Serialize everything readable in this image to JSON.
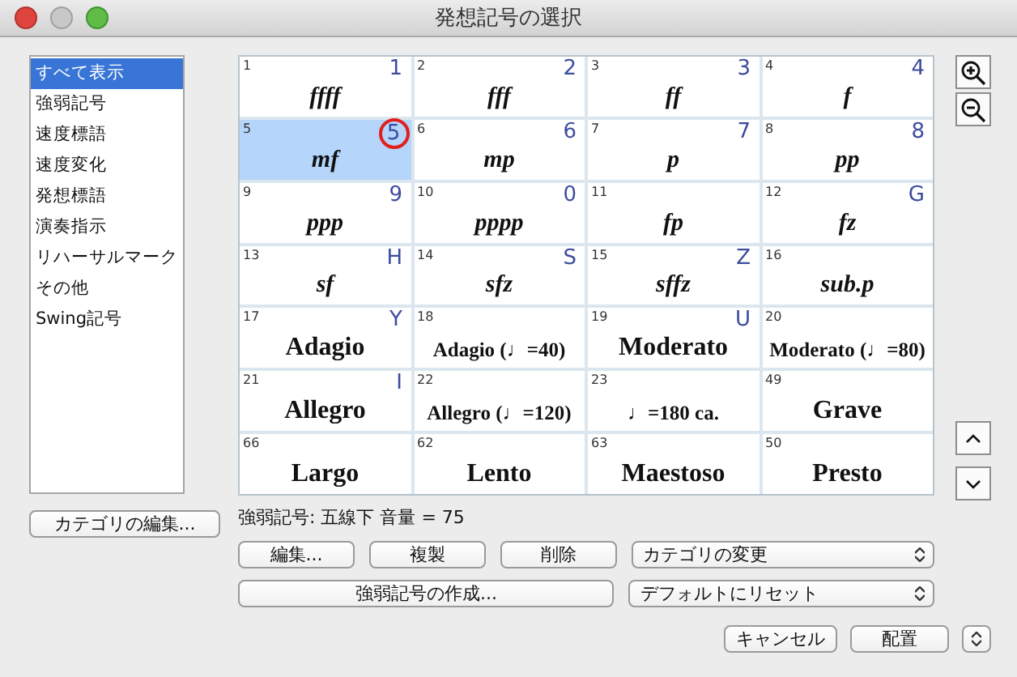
{
  "window": {
    "title": "発想記号の選択"
  },
  "categories": [
    {
      "label": "すべて表示",
      "selected": true
    },
    {
      "label": "強弱記号",
      "selected": false
    },
    {
      "label": "速度標語",
      "selected": false
    },
    {
      "label": "速度変化",
      "selected": false
    },
    {
      "label": "発想標語",
      "selected": false
    },
    {
      "label": "演奏指示",
      "selected": false
    },
    {
      "label": "リハーサルマーク",
      "selected": false
    },
    {
      "label": "その他",
      "selected": false
    },
    {
      "label": "Swing記号",
      "selected": false
    }
  ],
  "edit_categories_button": "カテゴリの編集...",
  "marks": [
    {
      "number": "1",
      "shortcut": "1",
      "label": "ffff",
      "kind": "dynamic",
      "selected": false
    },
    {
      "number": "2",
      "shortcut": "2",
      "label": "fff",
      "kind": "dynamic",
      "selected": false
    },
    {
      "number": "3",
      "shortcut": "3",
      "label": "ff",
      "kind": "dynamic",
      "selected": false
    },
    {
      "number": "4",
      "shortcut": "4",
      "label": "f",
      "kind": "dynamic",
      "selected": false
    },
    {
      "number": "5",
      "shortcut": "5",
      "label": "mf",
      "kind": "dynamic",
      "selected": true,
      "circled": true
    },
    {
      "number": "6",
      "shortcut": "6",
      "label": "mp",
      "kind": "dynamic",
      "selected": false
    },
    {
      "number": "7",
      "shortcut": "7",
      "label": "p",
      "kind": "dynamic",
      "selected": false
    },
    {
      "number": "8",
      "shortcut": "8",
      "label": "pp",
      "kind": "dynamic",
      "selected": false
    },
    {
      "number": "9",
      "shortcut": "9",
      "label": "ppp",
      "kind": "dynamic",
      "selected": false
    },
    {
      "number": "10",
      "shortcut": "0",
      "label": "pppp",
      "kind": "dynamic",
      "selected": false
    },
    {
      "number": "11",
      "label": "fp",
      "kind": "dynamic",
      "selected": false
    },
    {
      "number": "12",
      "shortcut": "G",
      "label": "fz",
      "kind": "dynamic",
      "selected": false
    },
    {
      "number": "13",
      "shortcut": "H",
      "label": "sf",
      "kind": "dynamic",
      "selected": false
    },
    {
      "number": "14",
      "shortcut": "S",
      "label": "sfz",
      "kind": "dynamic",
      "selected": false
    },
    {
      "number": "15",
      "shortcut": "Z",
      "label": "sffz",
      "kind": "dynamic",
      "selected": false
    },
    {
      "number": "16",
      "label": "sub.**p**",
      "kind": "dynamic",
      "selected": false
    },
    {
      "number": "17",
      "shortcut": "Y",
      "label": "Adagio",
      "kind": "tempo",
      "selected": false
    },
    {
      "number": "18",
      "label": "Adagio (♩=40)",
      "kind": "metronome",
      "selected": false
    },
    {
      "number": "19",
      "shortcut": "U",
      "label": "Moderato",
      "kind": "tempo",
      "selected": false
    },
    {
      "number": "20",
      "label": "Moderato (♩=80)",
      "kind": "metronome",
      "selected": false
    },
    {
      "number": "21",
      "shortcut": "I",
      "label": "Allegro",
      "kind": "tempo",
      "selected": false
    },
    {
      "number": "22",
      "label": "Allegro (♩=120)",
      "kind": "metronome",
      "selected": false
    },
    {
      "number": "23",
      "label": "♩=180 ca.",
      "kind": "metronome",
      "selected": false
    },
    {
      "number": "49",
      "label": "Grave",
      "kind": "tempo",
      "selected": false
    },
    {
      "number": "66",
      "label": "Largo",
      "kind": "tempo",
      "selected": false
    },
    {
      "number": "62",
      "label": "Lento",
      "kind": "tempo",
      "selected": false
    },
    {
      "number": "63",
      "label": "Maestoso",
      "kind": "tempo",
      "selected": false
    },
    {
      "number": "50",
      "label": "Presto",
      "kind": "tempo",
      "selected": false
    }
  ],
  "status": "強弱記号: 五線下 音量 = 75",
  "buttons": {
    "edit": "編集...",
    "duplicate": "複製",
    "delete": "削除",
    "create": "強弱記号の作成...",
    "cancel": "キャンセル",
    "place": "配置"
  },
  "dropdowns": {
    "change_category": "カテゴリの変更",
    "reset": "デフォルトにリセット"
  }
}
